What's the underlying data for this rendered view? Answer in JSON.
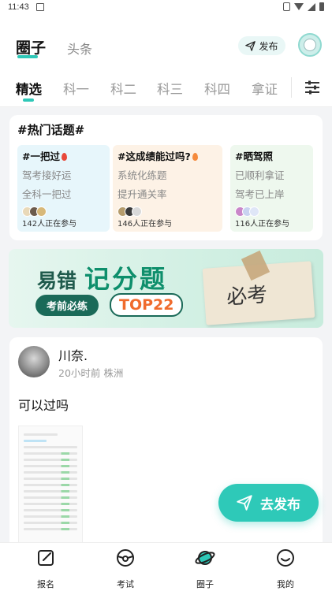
{
  "status_bar": {
    "time": "11:43"
  },
  "header": {
    "tabs": [
      "圈子",
      "头条"
    ],
    "publish_label": "发布"
  },
  "categories": [
    "精选",
    "科一",
    "科二",
    "科三",
    "科四",
    "拿证"
  ],
  "hot_topics": {
    "title": "#热门话题#",
    "items": [
      {
        "name": "#一把过",
        "lines": [
          "驾考接好运",
          "全科一把过"
        ],
        "count": "142人正在参与",
        "bg": "#e7f6fb"
      },
      {
        "name": "#这成绩能过吗?",
        "lines": [
          "系统化练题",
          "提升通关率"
        ],
        "count": "146人正在参与",
        "bg": "#fdf2e6"
      },
      {
        "name": "#晒驾照",
        "lines": [
          "已顺利拿证",
          "驾考已上岸"
        ],
        "count": "116人正在参与",
        "bg": "#eef8ee"
      }
    ]
  },
  "banner": {
    "title_small": "易错",
    "title_big": "记分题",
    "pill": "考前必练",
    "badge": "TOP22",
    "note": "必考"
  },
  "post": {
    "username": "川奈.",
    "meta": "20小时前 株洲",
    "text": "可以过吗"
  },
  "fab_label": "去发布",
  "bottom_nav": [
    "报名",
    "考试",
    "圈子",
    "我的"
  ],
  "colors": {
    "accent": "#2ec9b8",
    "banner_dark": "#1a6a58",
    "badge_orange": "#f06b2d"
  }
}
